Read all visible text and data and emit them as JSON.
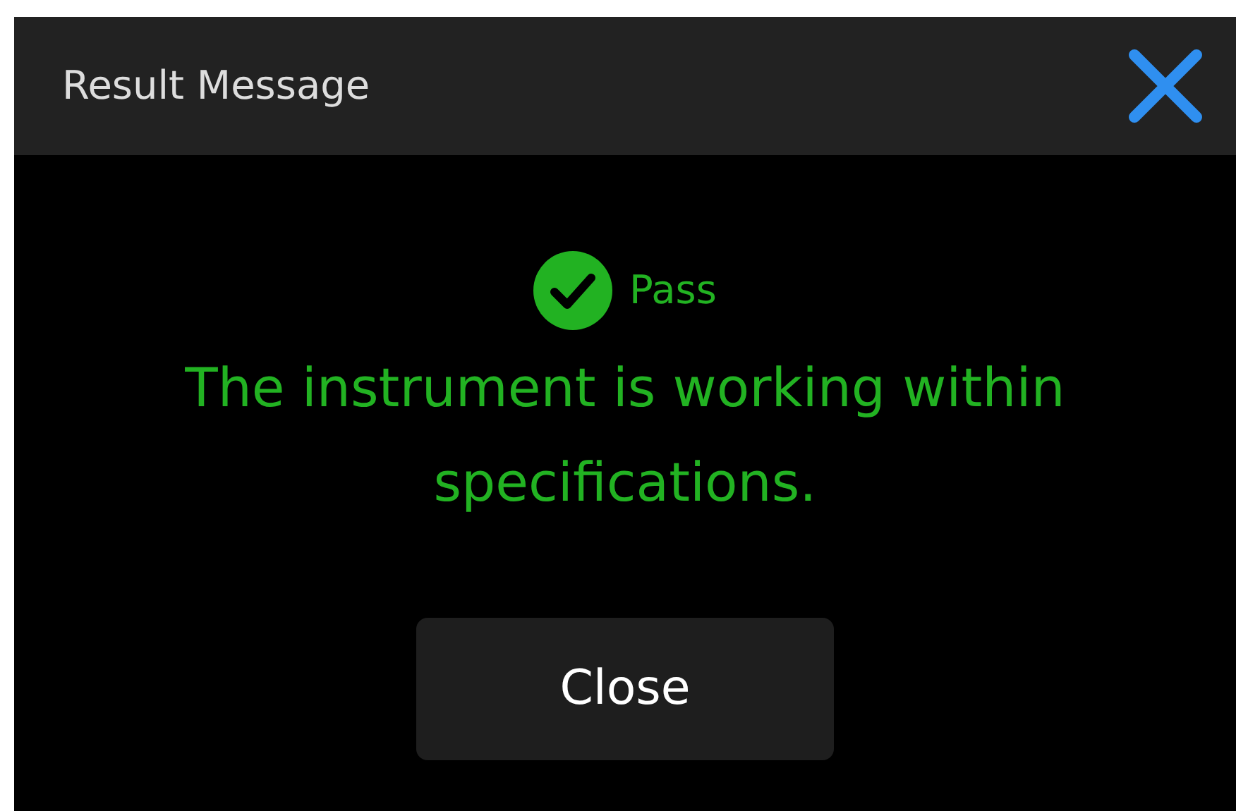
{
  "window": {
    "title": "Result Message"
  },
  "result": {
    "passed": true,
    "label": "Pass",
    "message": "The instrument is working within specifications."
  },
  "buttons": [
    "Close"
  ]
}
